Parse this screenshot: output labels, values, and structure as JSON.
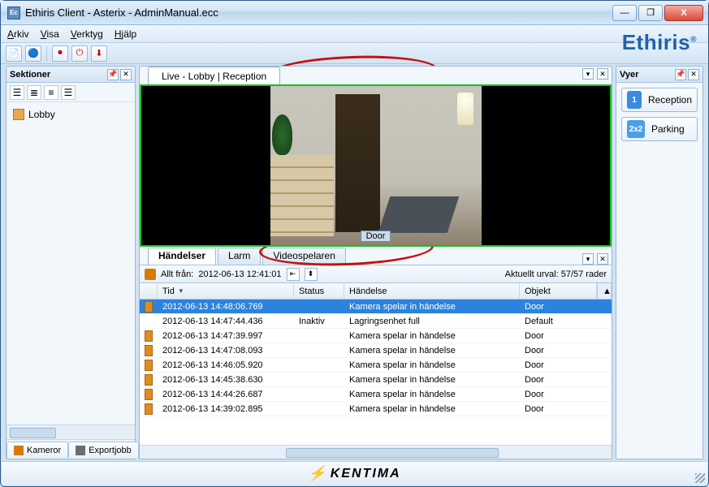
{
  "window": {
    "title": "Ethiris Client - Asterix - AdminManual.ecc",
    "app_icon_text": "Ec",
    "minimize": "—",
    "maximize": "❐",
    "close": "X"
  },
  "menu": {
    "items": [
      "Arkiv",
      "Visa",
      "Verktyg",
      "Hjälp"
    ]
  },
  "toolbar_icons": [
    "📄",
    "🔵",
    "⏺",
    "⏻",
    "⬇"
  ],
  "brand": "Ethiris",
  "left_panel": {
    "title": "Sektioner",
    "pin": "📌",
    "close": "✕",
    "toolbar": [
      "☰",
      "≣",
      "≡",
      "☰"
    ],
    "tree_item": "Lobby"
  },
  "bottom_tabs": {
    "cameras": "Kameror",
    "export": "Exportjobb"
  },
  "center": {
    "tab_label": "Live - Lobby | Reception",
    "cam_label": "Door",
    "dropdown": "▾",
    "close": "✕"
  },
  "events": {
    "tabs": [
      "Händelser",
      "Larm",
      "Videospelaren"
    ],
    "dropdown": "▾",
    "close": "✕",
    "filter_label": "Allt från:",
    "filter_value": "2012-06-13 12:41:01",
    "filter_btns": [
      "⇤",
      "⬍"
    ],
    "selection_label": "Aktuellt urval: 57/57 rader",
    "columns": {
      "tid": "Tid",
      "status": "Status",
      "handelse": "Händelse",
      "objekt": "Objekt"
    },
    "rows": [
      {
        "tid": "2012-06-13 14:48:06.769",
        "status": "",
        "handelse": "Kamera spelar in händelse",
        "objekt": "Door",
        "sel": true
      },
      {
        "tid": "2012-06-13 14:47:44.436",
        "status": "Inaktiv",
        "handelse": "Lagringsenhet full",
        "objekt": "Default",
        "noicon": true
      },
      {
        "tid": "2012-06-13 14:47:39.997",
        "status": "",
        "handelse": "Kamera spelar in händelse",
        "objekt": "Door"
      },
      {
        "tid": "2012-06-13 14:47:08.093",
        "status": "",
        "handelse": "Kamera spelar in händelse",
        "objekt": "Door"
      },
      {
        "tid": "2012-06-13 14:46:05.920",
        "status": "",
        "handelse": "Kamera spelar in händelse",
        "objekt": "Door"
      },
      {
        "tid": "2012-06-13 14:45:38.630",
        "status": "",
        "handelse": "Kamera spelar in händelse",
        "objekt": "Door"
      },
      {
        "tid": "2012-06-13 14:44:26.687",
        "status": "",
        "handelse": "Kamera spelar in händelse",
        "objekt": "Door"
      },
      {
        "tid": "2012-06-13 14:39:02.895",
        "status": "",
        "handelse": "Kamera spelar in händelse",
        "objekt": "Door"
      }
    ]
  },
  "right_panel": {
    "title": "Vyer",
    "pin": "📌",
    "close": "✕",
    "views": [
      {
        "icon": "1",
        "label": "Reception"
      },
      {
        "icon": "2x2",
        "label": "Parking"
      }
    ]
  },
  "status": {
    "brand": "KENTIMA"
  }
}
